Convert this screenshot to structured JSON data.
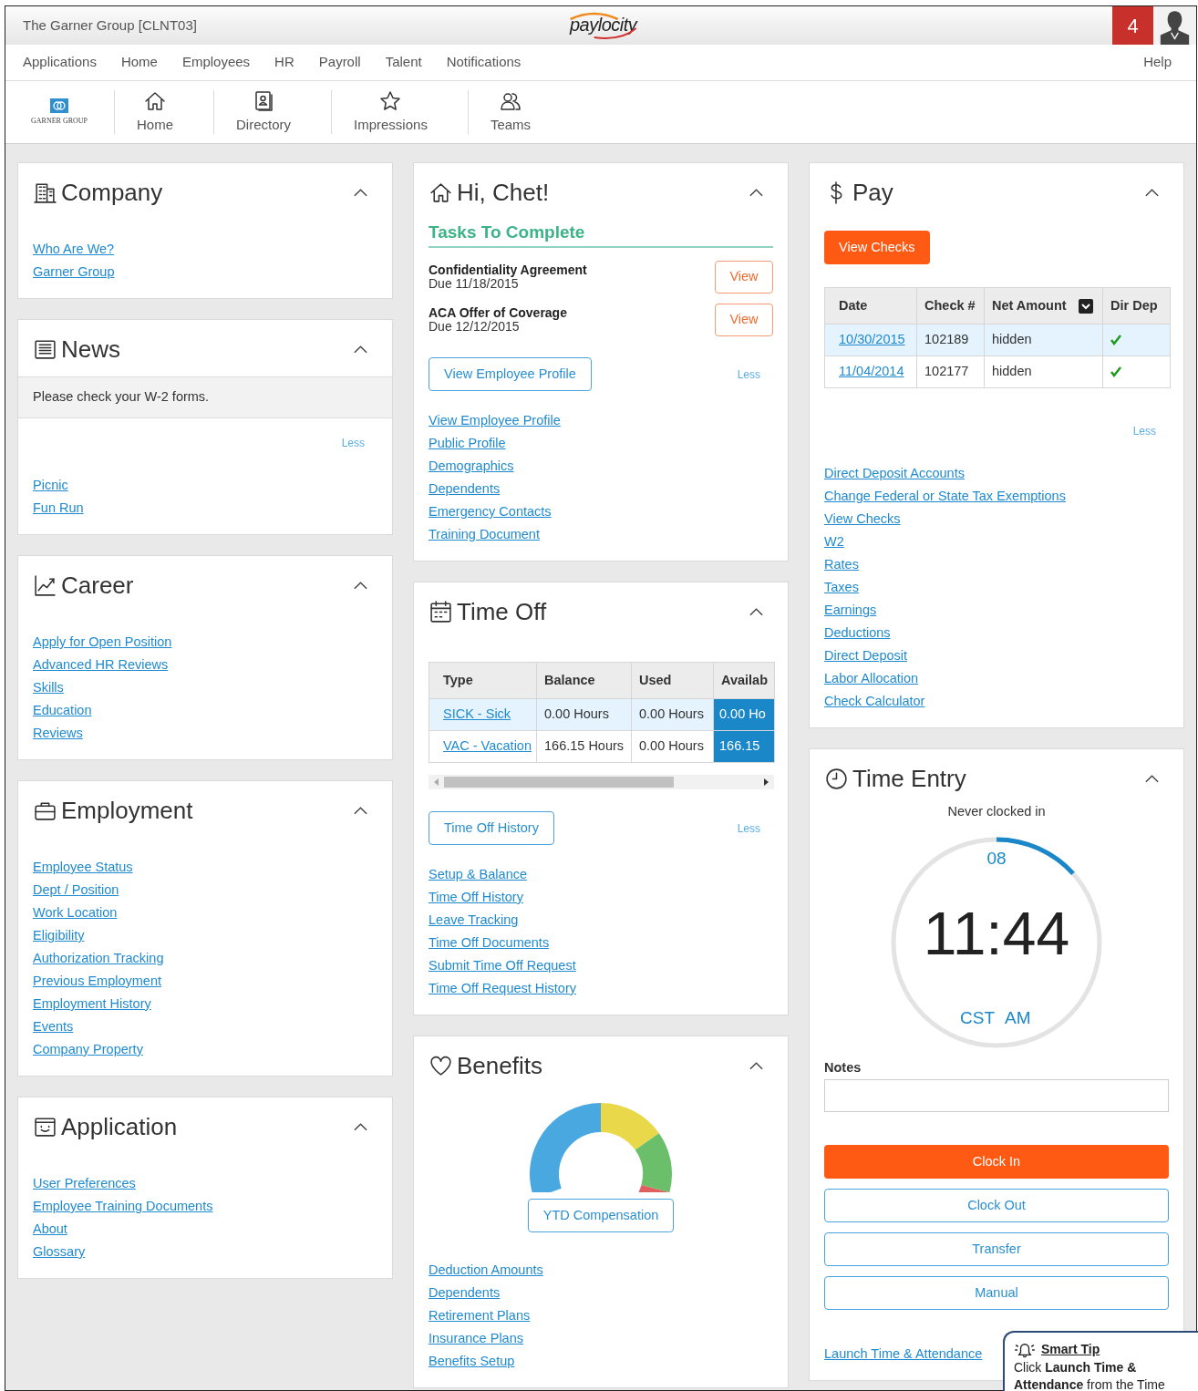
{
  "header": {
    "company": "The Garner Group [CLNT03]",
    "logo": "paylocity",
    "notification_count": "4"
  },
  "nav": {
    "items": [
      "Applications",
      "Home",
      "Employees",
      "HR",
      "Payroll",
      "Talent",
      "Notifications"
    ],
    "help": "Help"
  },
  "toolbar": {
    "logo_text": "GARNER GROUP",
    "items": [
      {
        "label": "Home",
        "kind": "home"
      },
      {
        "label": "Directory",
        "kind": "directory"
      },
      {
        "label": "Impressions",
        "kind": "impressions"
      },
      {
        "label": "Teams",
        "kind": "teams"
      }
    ]
  },
  "columns": [
    {
      "cards": [
        {
          "title": "Company",
          "kind": "company",
          "blocks": [
            {
              "kind": "links",
              "items": [
                "Who Are We?",
                "Garner Group"
              ]
            }
          ]
        },
        {
          "title": "News",
          "kind": "news",
          "blocks": [
            {
              "kind": "notice",
              "text": "Please check your W-2 forms."
            },
            {
              "kind": "less",
              "text": "Less"
            },
            {
              "kind": "links",
              "items": [
                "Picnic",
                "Fun Run"
              ]
            }
          ]
        },
        {
          "title": "Career",
          "kind": "career",
          "blocks": [
            {
              "kind": "links",
              "items": [
                "Apply for Open Position",
                "Advanced HR Reviews",
                "Skills",
                "Education",
                "Reviews"
              ]
            }
          ]
        },
        {
          "title": "Employment",
          "kind": "employment",
          "blocks": [
            {
              "kind": "links",
              "items": [
                "Employee Status",
                "Dept / Position",
                "Work Location",
                "Eligibility",
                "Authorization Tracking",
                "Previous Employment",
                "Employment History",
                "Events",
                "Company Property"
              ]
            }
          ]
        },
        {
          "title": "Application",
          "kind": "application",
          "blocks": [
            {
              "kind": "links",
              "items": [
                "User Preferences",
                "Employee Training Documents",
                "About",
                "Glossary"
              ]
            }
          ]
        }
      ]
    },
    {
      "cards": [
        {
          "title": "Hi, Chet!",
          "kind": "welcome",
          "blocks": [
            {
              "kind": "tasks",
              "heading": "Tasks To Complete",
              "items": [
                {
                  "title": "Confidentiality Agreement",
                  "due": "Due 11/18/2015",
                  "action": "View"
                },
                {
                  "title": "ACA Offer of Coverage",
                  "due": "Due 12/12/2015",
                  "action": "View"
                }
              ]
            },
            {
              "kind": "button_less",
              "button": "View Employee Profile",
              "less": "Less"
            },
            {
              "kind": "links",
              "items": [
                "View Employee Profile",
                "Public Profile",
                "Demographics",
                "Dependents",
                "Emergency Contacts",
                "Training Document"
              ]
            }
          ]
        },
        {
          "title": "Time Off",
          "kind": "time_off",
          "blocks": [
            {
              "kind": "balances_table",
              "columns": [
                {
                  "label": "Type"
                },
                {
                  "label": "Balance"
                },
                {
                  "label": "Used"
                },
                {
                  "label": "Availab"
                }
              ],
              "rows": [
                {
                  "selected": true,
                  "cells": [
                    {
                      "kind": "link",
                      "text": "SICK - Sick"
                    },
                    {
                      "kind": "text",
                      "text": "0.00 Hours"
                    },
                    {
                      "kind": "text",
                      "text": "0.00 Hours"
                    },
                    {
                      "kind": "highlight",
                      "text": "0.00 Ho"
                    }
                  ]
                },
                {
                  "selected": false,
                  "cells": [
                    {
                      "kind": "link",
                      "text": "VAC - Vacation"
                    },
                    {
                      "kind": "text",
                      "text": "166.15 Hours"
                    },
                    {
                      "kind": "text",
                      "text": "0.00 Hours"
                    },
                    {
                      "kind": "highlight",
                      "text": "166.15"
                    }
                  ]
                }
              ]
            },
            {
              "kind": "scrollbar"
            },
            {
              "kind": "button_less",
              "button": "Time Off History",
              "less": "Less"
            },
            {
              "kind": "links",
              "items": [
                "Setup & Balance",
                "Time Off History",
                "Leave Tracking",
                "Time Off Documents",
                "Submit Time Off Request",
                "Time Off Request History"
              ]
            }
          ]
        },
        {
          "title": "Benefits",
          "kind": "benefits",
          "blocks": [
            {
              "kind": "donut"
            },
            {
              "kind": "outline_button",
              "label": "YTD Compensation"
            },
            {
              "kind": "links",
              "items": [
                "Deduction Amounts",
                "Dependents",
                "Retirement Plans",
                "Insurance Plans",
                "Benefits Setup"
              ]
            }
          ]
        }
      ]
    },
    {
      "cards": [
        {
          "title": "Pay",
          "kind": "pay",
          "blocks": [
            {
              "kind": "primary_button",
              "label": "View Checks"
            },
            {
              "kind": "checks_table",
              "columns": [
                {
                  "label": "Date"
                },
                {
                  "label": "Check #"
                },
                {
                  "label": "Net Amount",
                  "menu": true
                },
                {
                  "label": "Dir Dep"
                }
              ],
              "rows": [
                {
                  "selected": true,
                  "cells": [
                    {
                      "kind": "link",
                      "text": "10/30/2015"
                    },
                    {
                      "kind": "text",
                      "text": "102189"
                    },
                    {
                      "kind": "text",
                      "text": "hidden"
                    },
                    {
                      "kind": "check",
                      "checked": true
                    }
                  ]
                },
                {
                  "selected": false,
                  "cells": [
                    {
                      "kind": "link",
                      "text": "11/04/2014"
                    },
                    {
                      "kind": "text",
                      "text": "102177"
                    },
                    {
                      "kind": "text",
                      "text": "hidden"
                    },
                    {
                      "kind": "check",
                      "checked": true
                    }
                  ]
                }
              ]
            },
            {
              "kind": "less",
              "text": "Less"
            },
            {
              "kind": "links",
              "items": [
                "Direct Deposit Accounts",
                "Change Federal or State Tax Exemptions",
                "View Checks",
                "W2",
                "Rates",
                "Taxes",
                "Earnings",
                "Deductions",
                "Direct Deposit",
                "Labor Allocation",
                "Check Calculator"
              ]
            }
          ]
        },
        {
          "title": "Time Entry",
          "kind": "time_entry",
          "blocks": [
            {
              "kind": "clock",
              "status": "Never clocked in",
              "seconds": "08",
              "time": "11:44",
              "zone": "CST",
              "period": "AM"
            },
            {
              "kind": "field",
              "label": "Notes"
            },
            {
              "kind": "action_buttons",
              "items": [
                {
                  "label": "Clock In",
                  "primary": true
                },
                {
                  "label": "Clock Out",
                  "primary": false
                },
                {
                  "label": "Transfer",
                  "primary": false
                },
                {
                  "label": "Manual",
                  "primary": false
                }
              ]
            },
            {
              "kind": "links",
              "items": [
                "Launch Time & Attendance"
              ]
            }
          ]
        }
      ]
    }
  ],
  "smart_tip": {
    "title": "Smart Tip",
    "text": "Click **Launch Time &** **Attendance** from the Time"
  }
}
